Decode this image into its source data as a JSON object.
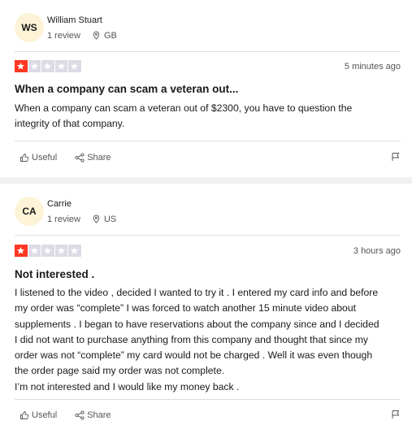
{
  "colors": {
    "star_filled": "#ff3722",
    "star_empty": "#dcdce6",
    "avatar_bg": "#fdf4d7",
    "divider": "#dedede"
  },
  "reviews": [
    {
      "initials": "WS",
      "name": "William Stuart",
      "review_count": "1 review",
      "country": "GB",
      "rating": 1,
      "rating_max": 5,
      "time": "5 minutes ago",
      "title": "When a company can scam a veteran out...",
      "body_lines": [
        "When a company can scam a veteran out of $2300, you have to question the integrity of that company."
      ],
      "useful_label": "Useful",
      "share_label": "Share"
    },
    {
      "initials": "CA",
      "name": "Carrie",
      "review_count": "1 review",
      "country": "US",
      "rating": 1,
      "rating_max": 5,
      "time": "3 hours ago",
      "title": "Not interested .",
      "body_lines": [
        "I listened to the video , decided I wanted to try it . I entered my card info and before my order was “complete” I was forced to watch another 15 minute video about supplements . I began to have reservations about the company since and I decided I did not want to purchase anything from this company and thought that since my order was not “complete” my card would not be charged . Well it was even though the order page said my order was not complete.",
        "I’m not interested and I would like my money back ."
      ],
      "useful_label": "Useful",
      "share_label": "Share"
    }
  ],
  "icons": {
    "location": "pin-icon",
    "useful": "thumbs-up-icon",
    "share": "share-icon",
    "flag": "flag-icon",
    "star": "star-icon"
  }
}
